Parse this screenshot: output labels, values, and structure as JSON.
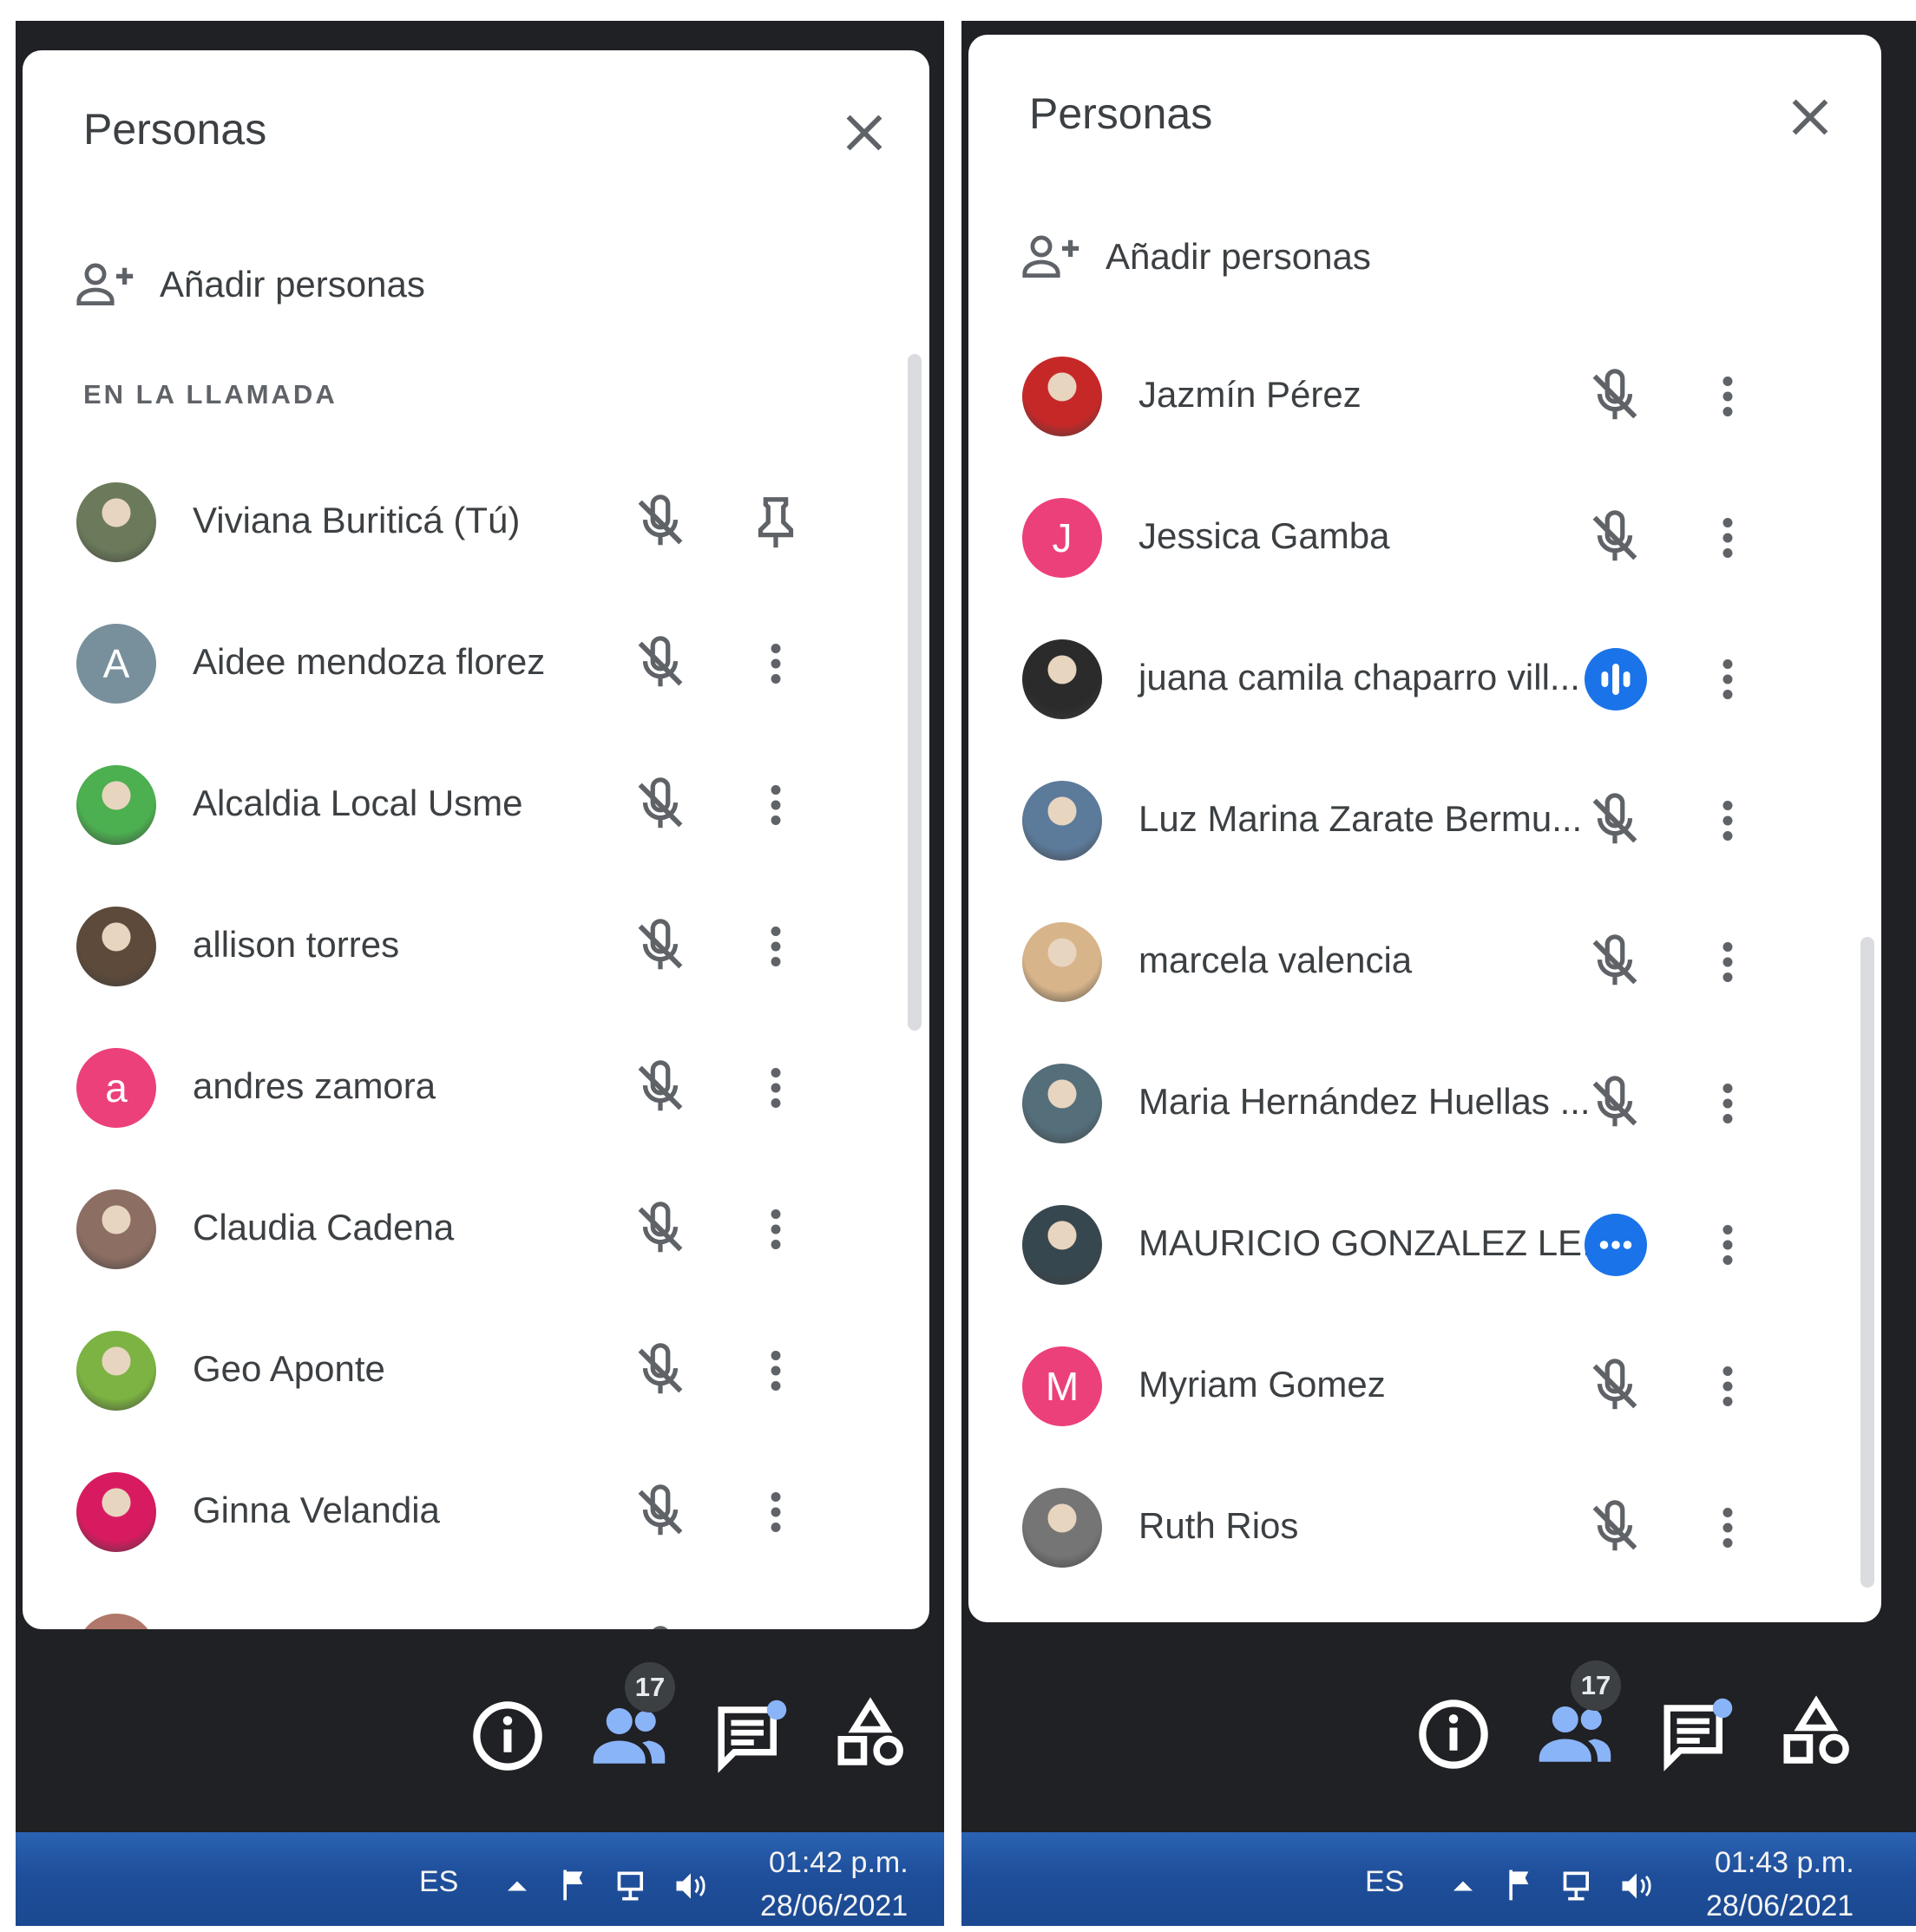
{
  "screens": [
    {
      "panel": {
        "title": "Personas",
        "add_label": "Añadir personas",
        "section_label": "EN LA LLAMADA"
      },
      "participants": [
        {
          "name": "Viviana Buriticá (Tú)",
          "avatar": {
            "type": "photo",
            "color": "#6b7a5a"
          },
          "status": "muted",
          "action": "pin"
        },
        {
          "name": "Aidee mendoza florez",
          "avatar": {
            "type": "letter",
            "letter": "A",
            "color": "#78909c"
          },
          "status": "muted",
          "action": "menu"
        },
        {
          "name": "Alcaldia Local Usme",
          "avatar": {
            "type": "photo",
            "color": "#4caf50"
          },
          "status": "muted",
          "action": "menu"
        },
        {
          "name": "allison torres",
          "avatar": {
            "type": "photo",
            "color": "#5d4a3a"
          },
          "status": "muted",
          "action": "menu"
        },
        {
          "name": "andres zamora",
          "avatar": {
            "type": "letter",
            "letter": "a",
            "color": "#ec407a"
          },
          "status": "muted",
          "action": "menu"
        },
        {
          "name": "Claudia Cadena",
          "avatar": {
            "type": "photo",
            "color": "#8d6e63"
          },
          "status": "muted",
          "action": "menu"
        },
        {
          "name": "Geo Aponte",
          "avatar": {
            "type": "photo",
            "color": "#7cb342"
          },
          "status": "muted",
          "action": "menu"
        },
        {
          "name": "Ginna Velandia",
          "avatar": {
            "type": "photo",
            "color": "#d81b60"
          },
          "status": "muted",
          "action": "menu"
        },
        {
          "name": "",
          "avatar": {
            "type": "photo",
            "color": "#b0786a"
          },
          "status": "muted",
          "action": "menu"
        }
      ],
      "toolbar": {
        "participant_count": "17"
      },
      "taskbar": {
        "language": "ES",
        "time": "01:42 p.m.",
        "date": "28/06/2021"
      }
    },
    {
      "panel": {
        "title": "Personas",
        "add_label": "Añadir personas"
      },
      "participants": [
        {
          "name": "",
          "avatar": {
            "type": "photo",
            "color": "#7a3a4a"
          },
          "status": "muted",
          "action": "menu"
        },
        {
          "name": "Jazmín Pérez",
          "avatar": {
            "type": "photo",
            "color": "#c62828"
          },
          "status": "muted",
          "action": "menu"
        },
        {
          "name": "Jessica Gamba",
          "avatar": {
            "type": "letter",
            "letter": "J",
            "color": "#ec407a"
          },
          "status": "muted",
          "action": "menu"
        },
        {
          "name": "juana camila chaparro vill...",
          "avatar": {
            "type": "photo",
            "color": "#2b2b2b"
          },
          "status": "speaking",
          "action": "menu"
        },
        {
          "name": "Luz Marina Zarate Bermu...",
          "avatar": {
            "type": "photo",
            "color": "#5c7a9a"
          },
          "status": "muted",
          "action": "menu"
        },
        {
          "name": "marcela valencia",
          "avatar": {
            "type": "photo",
            "color": "#d7b48a"
          },
          "status": "muted",
          "action": "menu"
        },
        {
          "name": "Maria Hernández Huellas ...",
          "avatar": {
            "type": "photo",
            "color": "#546e7a"
          },
          "status": "muted",
          "action": "menu"
        },
        {
          "name": "MAURICIO GONZALEZ LE...",
          "avatar": {
            "type": "photo",
            "color": "#37474f"
          },
          "status": "connecting",
          "action": "menu"
        },
        {
          "name": "Myriam Gomez",
          "avatar": {
            "type": "letter",
            "letter": "M",
            "color": "#ec407a"
          },
          "status": "muted",
          "action": "menu"
        },
        {
          "name": "Ruth Rios",
          "avatar": {
            "type": "photo",
            "color": "#757575"
          },
          "status": "muted",
          "action": "menu"
        }
      ],
      "toolbar": {
        "participant_count": "17"
      },
      "taskbar": {
        "language": "ES",
        "time": "01:43 p.m.",
        "date": "28/06/2021"
      }
    }
  ],
  "colors": {
    "accent": "#1a73e8",
    "dark_background": "#202124",
    "taskbar": "#1f4f9b",
    "icon_gray": "#5f6368"
  }
}
